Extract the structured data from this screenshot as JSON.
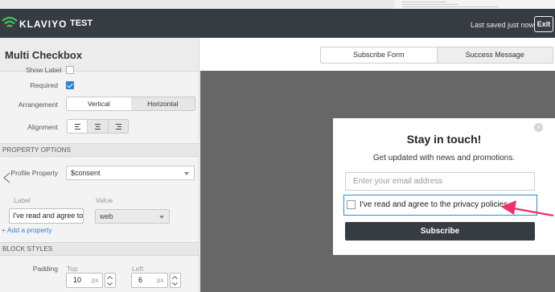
{
  "app": {
    "logo_text": "KLAVIYO",
    "account_label": "TEST",
    "status_text": "Last saved just now",
    "exit_label": "Exit"
  },
  "panel": {
    "title": "Multi Checkbox",
    "show_label_text": "Show Label",
    "required_label": "Required",
    "required_checked": true,
    "arrangement_label": "Arrangement",
    "arrangement_options": [
      "Vertical",
      "Horizontal"
    ],
    "arrangement_selected": "Vertical",
    "alignment_label": "Alignment",
    "alignment_options": [
      "align-left-icon",
      "align-center-icon",
      "align-right-icon"
    ],
    "alignment_selected": "left"
  },
  "property_options": {
    "section_label": "PROPERTY OPTIONS",
    "profile_property_label": "Profile Property",
    "profile_property_value": "$consent",
    "label_header": "Label",
    "value_header": "Value",
    "label_input_value": "I've read and agree to",
    "value_select_value": "web",
    "add_property_label": "+ Add a property"
  },
  "block_styles": {
    "section_label": "BLOCK STYLES",
    "padding_label": "Padding",
    "top_label": "Top",
    "top_value": "10",
    "left_label": "Left",
    "left_value": "6",
    "unit": "px"
  },
  "tabs": {
    "items": [
      "Subscribe Form",
      "Success Message"
    ],
    "selected": "Subscribe Form"
  },
  "form_preview": {
    "close_symbol": "×",
    "title": "Stay in touch!",
    "subtitle": "Get updated with news and promotions.",
    "email_placeholder": "Enter your email address",
    "consent_text": "I've read and agree to the privacy policies",
    "button_label": "Subscribe"
  },
  "colors": {
    "topbar": "#363c42",
    "accent_blue": "#2f80d1",
    "highlight_border": "#1f93e0",
    "annotation_arrow": "#f0306a",
    "logo_green": "#3fc65e",
    "canvas_background": "#676767"
  }
}
